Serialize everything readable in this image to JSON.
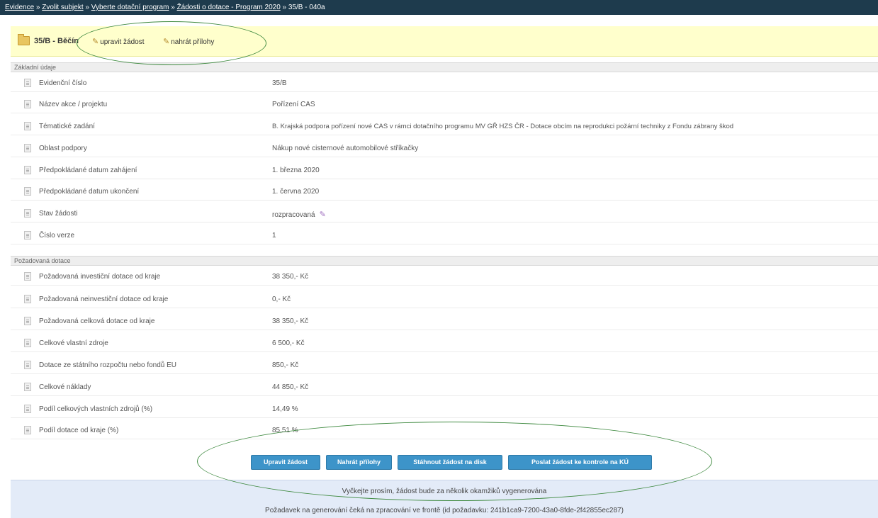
{
  "breadcrumb": {
    "items": [
      "Evidence",
      "Zvolit subjekt",
      "Vyberte dotační program",
      "Žádosti o dotace - Program 2020"
    ],
    "separator": "»",
    "current": "35/B - 040a"
  },
  "header": {
    "title": "35/B - Běčín",
    "edit_link": "upravit žádost",
    "upload_link": "nahrát přílohy"
  },
  "sections": {
    "basic": "Základní údaje",
    "subsidy": "Požadovaná dotace"
  },
  "basic_rows": [
    {
      "label": "Evidenční číslo",
      "value": "35/B"
    },
    {
      "label": "Název akce / projektu",
      "value": "Pořízení CAS"
    },
    {
      "label": "Tématické zadání",
      "value": "B. Krajská podpora pořízení nové CAS v rámci dotačního programu MV GŘ HZS ČR - Dotace obcím na reprodukci požární techniky z Fondu zábrany škod"
    },
    {
      "label": "Oblast podpory",
      "value": "Nákup nové cisternové automobilové stříkačky"
    },
    {
      "label": "Předpokládané datum zahájení",
      "value": "1. března 2020"
    },
    {
      "label": "Předpokládané datum ukončení",
      "value": "1. června 2020"
    },
    {
      "label": "Stav žádosti",
      "value": "rozpracovaná"
    },
    {
      "label": "Číslo verze",
      "value": "1"
    }
  ],
  "subsidy_rows": [
    {
      "label": "Požadovaná investiční dotace od kraje",
      "value": "38 350,- Kč"
    },
    {
      "label": "Požadovaná neinvestiční dotace od kraje",
      "value": "0,- Kč"
    },
    {
      "label": "Požadovaná celková dotace od kraje",
      "value": "38 350,- Kč"
    },
    {
      "label": "Celkové vlastní zdroje",
      "value": "6 500,- Kč"
    },
    {
      "label": "Dotace ze státního rozpočtu nebo fondů EU",
      "value": "850,- Kč"
    },
    {
      "label": "Celkové náklady",
      "value": "44 850,- Kč"
    },
    {
      "label": "Podíl celkových vlastních zdrojů (%)",
      "value": "14,49 %"
    },
    {
      "label": "Podíl dotace od kraje (%)",
      "value": "85,51 %"
    }
  ],
  "buttons": {
    "edit": "Upravit žádost",
    "upload": "Nahrát přílohy",
    "download": "Stáhnout žádost na disk",
    "send": "Poslat žádost ke kontrole na KÚ"
  },
  "info": {
    "line1": "Vyčkejte prosím, žádost bude za několik okamžiků vygenerována",
    "line2": "Požadavek na generování čeká na zpracování ve frontě (id požadavku: 241b1ca9-7200-43a0-8fde-2f42855ec287)"
  },
  "icons": {
    "folder": "folder-icon",
    "pencil": "pencil-icon",
    "document": "document-icon",
    "status": "edit-status-icon"
  },
  "colors": {
    "topbar": "#1e3b4d",
    "title_bg": "#ffffcc",
    "button": "#3d94c9",
    "info_bg": "#e3ebf8",
    "annotation": "#3f8a40"
  }
}
